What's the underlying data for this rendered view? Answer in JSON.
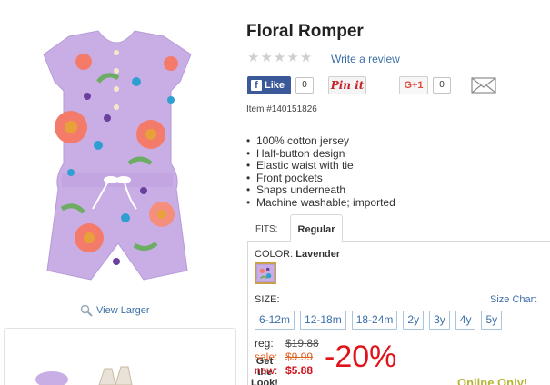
{
  "product": {
    "title": "Floral Romper",
    "item_number": "Item #140151826",
    "rating_stars": 0,
    "review_link": "Write a review"
  },
  "social": {
    "facebook_label": "Like",
    "facebook_count": "0",
    "pinit_label": "Pin it",
    "gplus_label": "G+1",
    "gplus_count": "0",
    "email_icon": "envelope-icon"
  },
  "features": [
    "100% cotton jersey",
    "Half-button design",
    "Elastic waist with tie",
    "Front pockets",
    "Snaps underneath",
    "Machine washable; imported"
  ],
  "fits": {
    "label": "FITS:",
    "active_tab": "Regular"
  },
  "color": {
    "label": "COLOR:",
    "value": "Lavender",
    "swatch_color": "#b9a0dc"
  },
  "size": {
    "label": "SIZE:",
    "chart_link": "Size Chart",
    "options": [
      "6-12m",
      "12-18m",
      "18-24m",
      "2y",
      "3y",
      "4y",
      "5y"
    ]
  },
  "price": {
    "reg_label": "reg:",
    "reg_amount": "$19.88",
    "sale_label": "sale:",
    "sale_amount": "$9.99",
    "now_label": "now:",
    "now_amount": "$5.88",
    "discount": "-20%"
  },
  "badge": "Online Only!",
  "left": {
    "view_larger": "View Larger",
    "get_the_look": "Get the Look!"
  },
  "colors": {
    "link": "#3b6fa8",
    "sale": "#e06020",
    "now": "#d3141a",
    "discount": "#e0131b",
    "online_only": "#b6b430",
    "romper": "#c9aee6"
  }
}
